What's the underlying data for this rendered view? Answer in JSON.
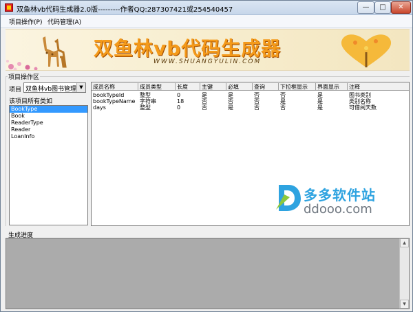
{
  "window": {
    "title": "双鱼林vb代码生成器2.0版---------作者QQ:287307421或254540457",
    "min_label": "—",
    "max_label": "□",
    "close_label": "✕"
  },
  "menu": {
    "items": [
      "项目操作(P)",
      "代码管理(A)"
    ]
  },
  "banner": {
    "title": "双鱼林vb代码生成器",
    "url": "WWW.SHUANGYULIN.COM"
  },
  "project_panel": {
    "section_label": "项目操作区",
    "project_label": "项目",
    "project_value": "双鱼林vb图书管理",
    "classes_label": "该项目所有类如",
    "classes": [
      "BookType",
      "Book",
      "ReaderType",
      "Reader",
      "LoanInfo"
    ],
    "selected_index": 0
  },
  "grid": {
    "columns": [
      "成员名称",
      "成员类型",
      "长度",
      "主键",
      "必填",
      "查询",
      "下拉框显示",
      "界面显示",
      "注释"
    ],
    "rows": [
      [
        "bookTypeId",
        "整型",
        "0",
        "是",
        "是",
        "否",
        "否",
        "是",
        "图书类别"
      ],
      [
        "bookTypeName",
        "字符串",
        "18",
        "否",
        "否",
        "否",
        "是",
        "是",
        "类别名称"
      ],
      [
        "days",
        "整型",
        "0",
        "否",
        "是",
        "否",
        "否",
        "是",
        "可借阅天数"
      ]
    ]
  },
  "progress": {
    "section_label": "生成进度"
  },
  "watermark": {
    "cn": "多多软件站",
    "en": "ddooo.com"
  },
  "colors": {
    "selection": "#3399ff",
    "banner_title": "#f49a1a",
    "progress_bg": "#ababab",
    "watermark_blue": "#2ea3e0"
  }
}
